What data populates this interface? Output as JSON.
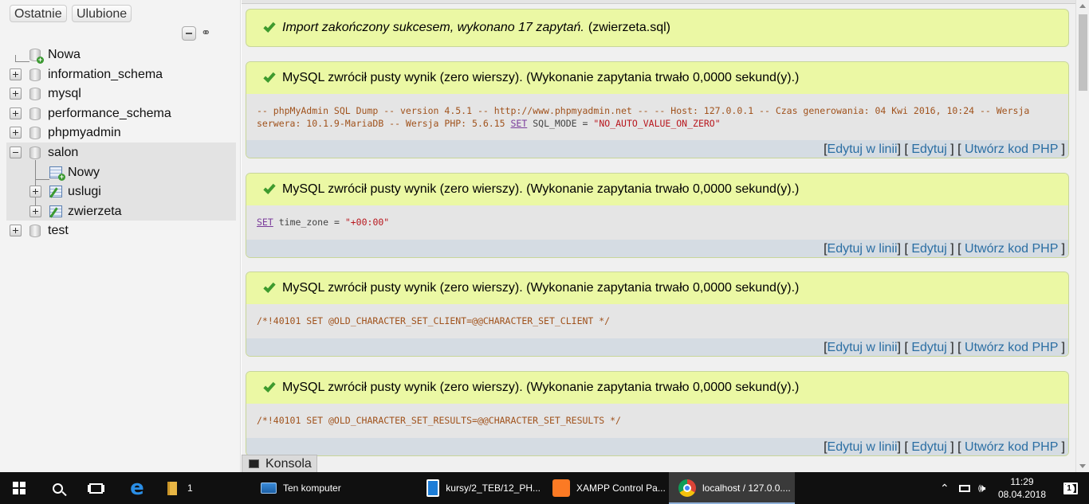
{
  "nav": {
    "tabs": [
      "Ostatnie",
      "Ulubione"
    ],
    "tree": {
      "new_db": "Nowa",
      "databases": [
        "information_schema",
        "mysql",
        "performance_schema",
        "phpmyadmin",
        "salon",
        "test"
      ],
      "salon_children": {
        "new_table": "Nowy",
        "tables": [
          "uslugi",
          "zwierzeta"
        ]
      }
    }
  },
  "main": {
    "success_message": {
      "italic": "Import zakończony sukcesem, wykonano 17 zapytań.",
      "file": "(zwierzeta.sql)"
    },
    "result_message": "MySQL zwrócił pusty wynik (zero wierszy). (Wykonanie zapytania trwało 0,0000 sekund(y).)",
    "queries": [
      {
        "pre": "-- phpMyAdmin SQL Dump -- version 4.5.1 -- http://www.phpmyadmin.net -- -- Host: 127.0.0.1 -- Czas generowania: 04 Kwi 2016, 10:24 -- Wersja serwera: 10.1.9-MariaDB -- Wersja PHP: 5.6.15",
        "kw": "SET",
        "mid": "SQL_MODE =",
        "str": "\"NO_AUTO_VALUE_ON_ZERO\""
      },
      {
        "pre": "",
        "kw": "SET",
        "mid": "time_zone =",
        "str": "\"+00:00\""
      },
      {
        "pre": "/*!40101 SET @OLD_CHARACTER_SET_CLIENT=@@CHARACTER_SET_CLIENT */"
      },
      {
        "pre": "/*!40101 SET @OLD_CHARACTER_SET_RESULTS=@@CHARACTER_SET_RESULTS */"
      }
    ],
    "links": {
      "inline_edit": "Edytuj w linii",
      "edit": "Edytuj",
      "create_php": "Utwórz kod PHP"
    },
    "console_label": "Konsola"
  },
  "taskbar": {
    "explorer_badge": "1",
    "apps": [
      {
        "id": "computer",
        "label": "Ten komputer"
      },
      {
        "id": "folder",
        "label": "kursy/2_TEB/12_PH..."
      },
      {
        "id": "xampp",
        "label": "XAMPP Control Pa..."
      },
      {
        "id": "chrome",
        "label": "localhost / 127.0.0...."
      }
    ],
    "clock": {
      "time": "11:29",
      "date": "08.04.2018"
    },
    "notification_count": "1"
  }
}
